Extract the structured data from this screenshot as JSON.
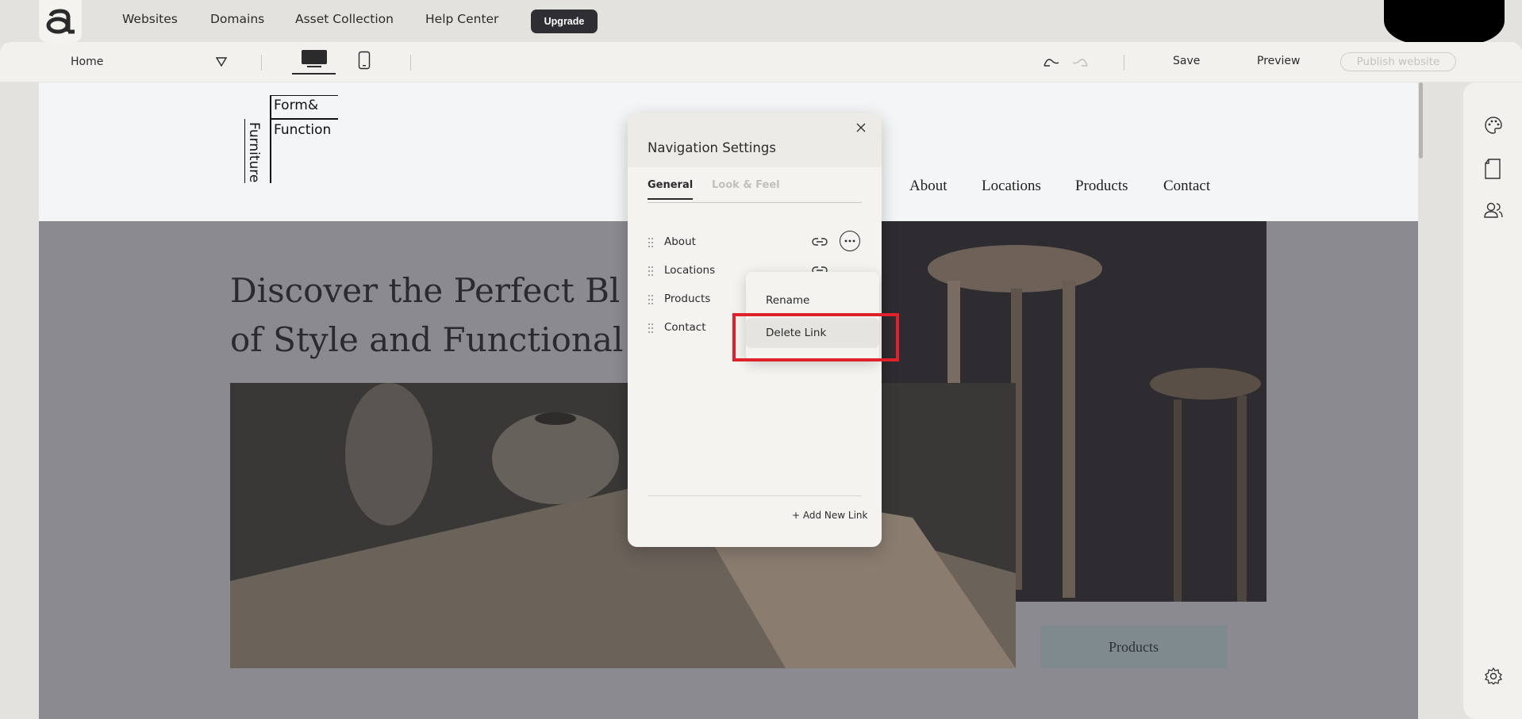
{
  "topnav": {
    "links": [
      "Websites",
      "Domains",
      "Asset Collection",
      "Help Center"
    ],
    "upgrade_label": "Upgrade"
  },
  "toolbar": {
    "page_select": "Home",
    "save_label": "Save",
    "preview_label": "Preview",
    "publish_label": "Publish website"
  },
  "site": {
    "brand_line1": "Form&",
    "brand_line2": "Function",
    "brand_vertical": "Furniture",
    "nav": [
      "About",
      "Locations",
      "Products",
      "Contact"
    ],
    "hero_title": "Discover the Perfect Bl\nof Style and Functional",
    "cta_label": "Products"
  },
  "modal": {
    "title": "Navigation Settings",
    "tabs": [
      "General",
      "Look & Feel"
    ],
    "links": [
      "About",
      "Locations",
      "Products",
      "Contact"
    ],
    "add_link_label": "+ Add New Link"
  },
  "context_menu": {
    "items": [
      "Rename",
      "Delete Link"
    ]
  },
  "colors": {
    "accent_highlight": "#e0202a",
    "upgrade_bg": "#2f2f33"
  }
}
